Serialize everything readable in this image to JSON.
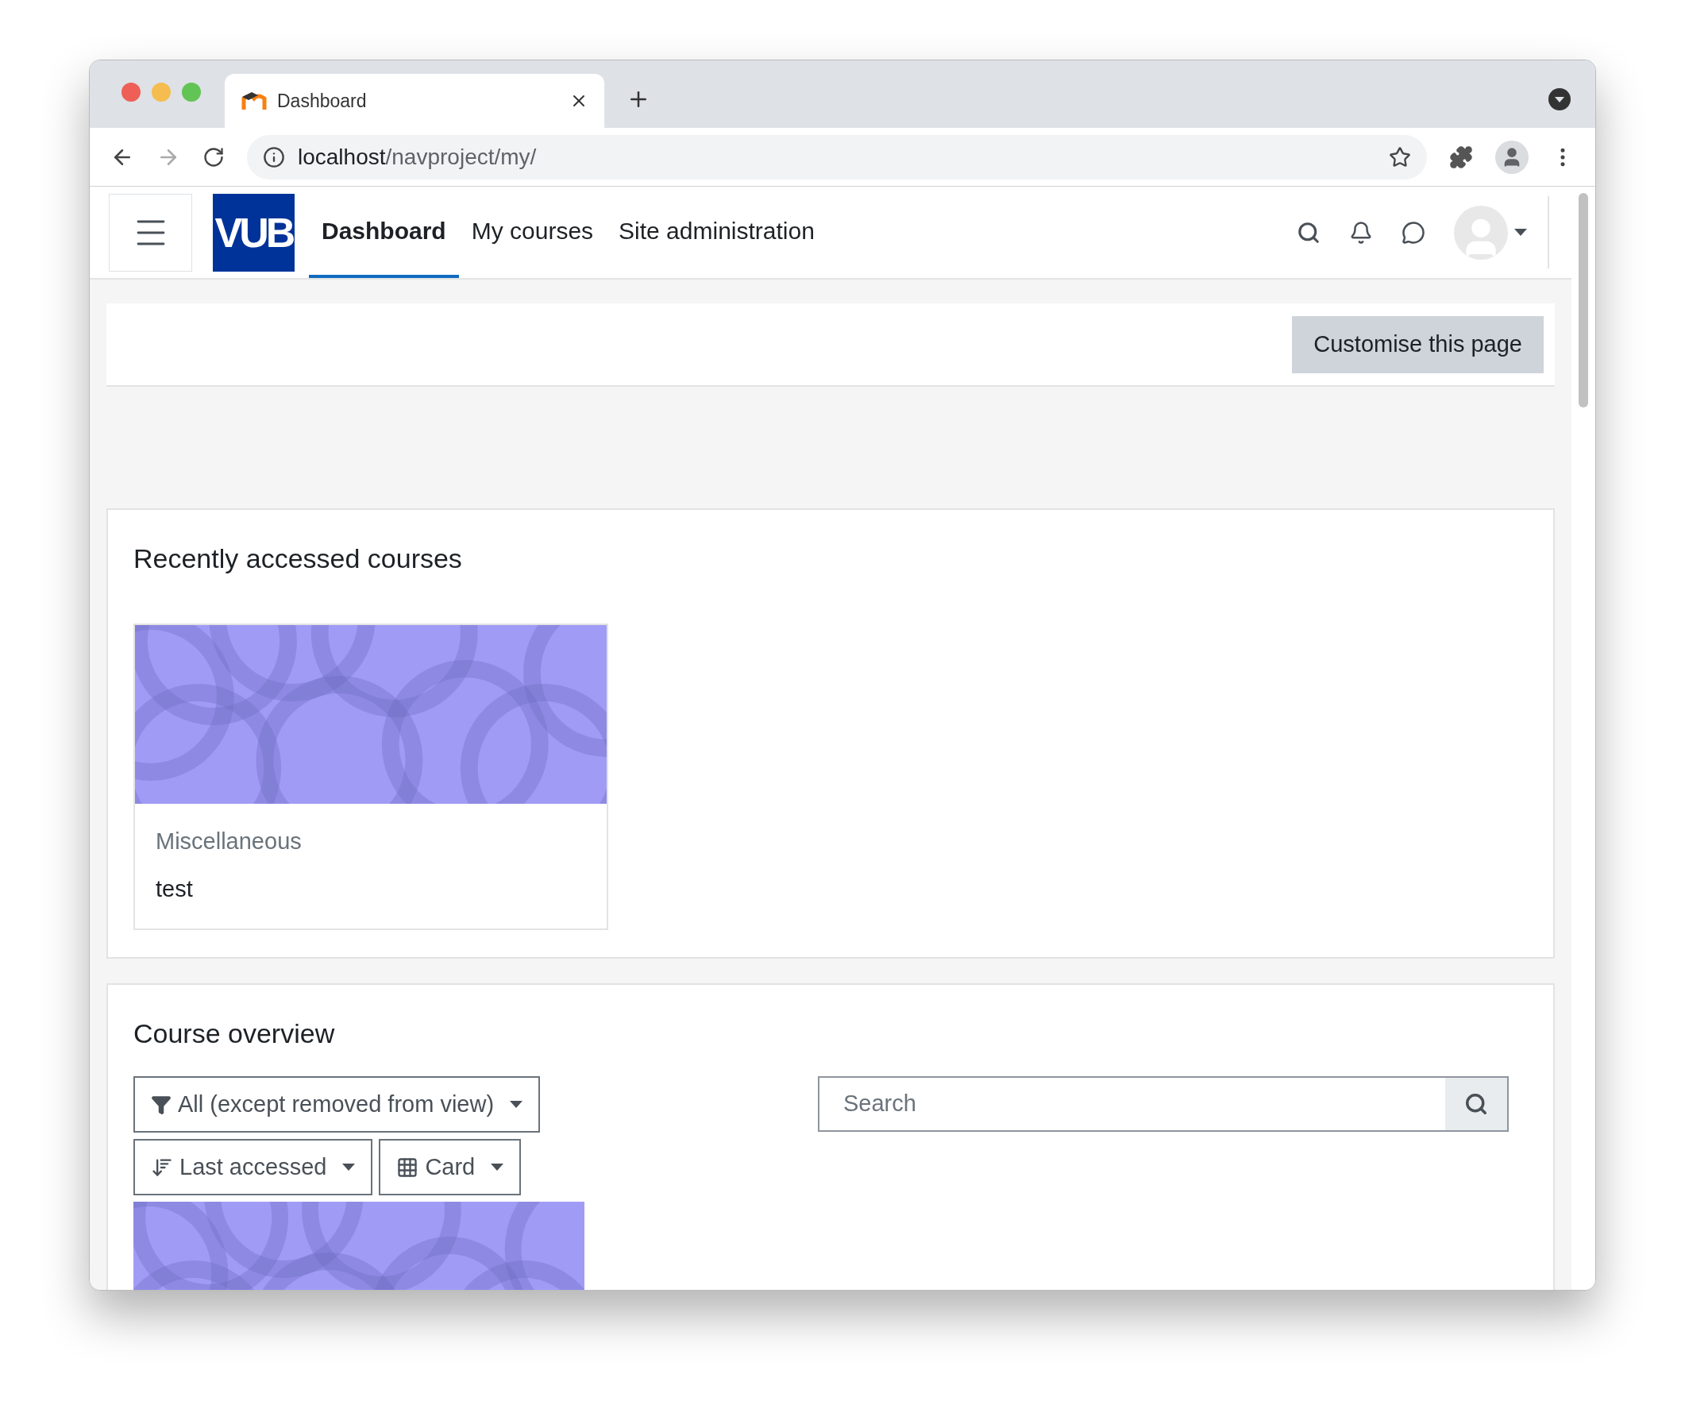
{
  "browser": {
    "tab_title": "Dashboard",
    "url_host": "localhost",
    "url_path": "/navproject/my/"
  },
  "navbar": {
    "logo": "VUB",
    "items": [
      {
        "label": "Dashboard",
        "selected": true
      },
      {
        "label": "My courses",
        "selected": false
      },
      {
        "label": "Site administration",
        "selected": false
      }
    ]
  },
  "customise_button": "Customise this page",
  "recent": {
    "title": "Recently accessed courses",
    "courses": [
      {
        "category": "Miscellaneous",
        "name": "test"
      }
    ]
  },
  "overview": {
    "title": "Course overview",
    "filters": [
      {
        "kind": "filter",
        "label": "All (except removed from view)"
      },
      {
        "kind": "sort",
        "label": "Last accessed"
      },
      {
        "kind": "view",
        "label": "Card"
      }
    ],
    "search": {
      "placeholder": "Search"
    }
  }
}
